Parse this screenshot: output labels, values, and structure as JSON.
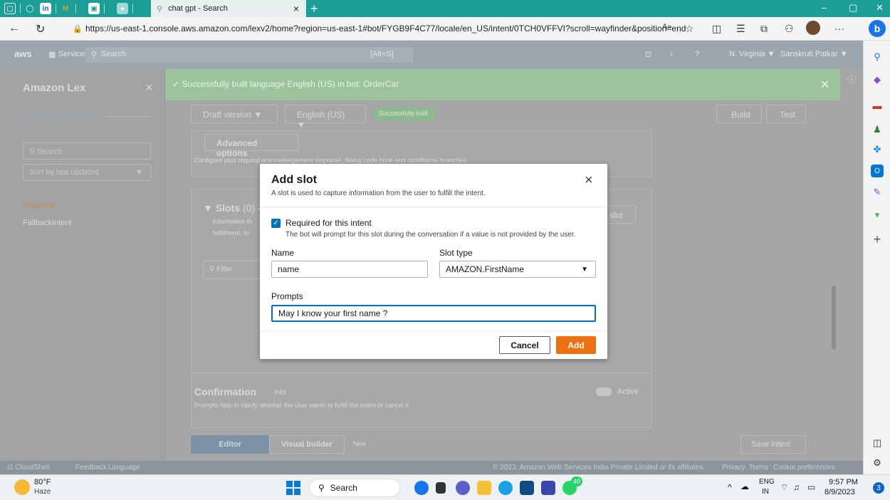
{
  "browser": {
    "tab_title": "chat gpt - Search",
    "tab_close": "×",
    "new_tab": "+",
    "url": "https://us-east-1.console.aws.amazon.com/lexv2/home?region=us-east-1#bot/FYGB9F4C77/locale/en_US/intent/0TCH0VFFVI?scroll=wayfinder&position=end",
    "profile_letter": "b"
  },
  "aws_nav": {
    "logo": "aws",
    "services": "Services",
    "search": "Search",
    "shortcut": "[Alt+S]",
    "region": "N. Virginia ▼",
    "user": "Sanskruti Patkar ▼"
  },
  "lex_sidebar": {
    "title": "Amazon Lex",
    "close": "×",
    "back_link": "Back to intents list (2)",
    "search_placeholder": "Search",
    "sort": "Sort by last updated",
    "intents": [
      "OrderCar",
      "FallbackIntent"
    ]
  },
  "flash": {
    "message": "Successfully built language English (US) in bot: OrderCar"
  },
  "editor": {
    "draft_version": "Draft version ▼",
    "language": "English (US) ▼",
    "build_status": "Successfully built",
    "build_button": "Build",
    "test_button": "Test",
    "advanced_options": "Advanced options",
    "advanced_desc": "Configure your request acknowledgement response, dialog code hook and conditional branches.",
    "slots_title": "Slots",
    "slots_count": "(0) -",
    "slots_desc_1": "Information th",
    "slots_desc_2": "fulfillment. In",
    "filter_placeholder": "Filter",
    "add_slot": "slot",
    "confirmation_title": "Confirmation",
    "confirmation_info": "Info",
    "confirmation_desc": "Prompts help to clarify whether the user wants to fulfill the intent or cancel it",
    "active_label": "Active",
    "tab_editor": "Editor",
    "tab_visual": "Visual builder",
    "tab_new": "New",
    "save_intent": "Save intent"
  },
  "footer": {
    "cloudshell": "CloudShell",
    "feedback": "Feedback",
    "language": "Language",
    "copyright": "© 2023, Amazon Web Services India Private Limited or its affiliates.",
    "privacy": "Privacy",
    "terms": "Terms",
    "cookies": "Cookie preferences"
  },
  "modal": {
    "title": "Add slot",
    "subtitle": "A slot is used to capture information from the user to fulfill the intent.",
    "required_label": "Required for this intent",
    "required_hint": "The bot will prompt for this slot during the conversation if a value is not provided by the user.",
    "required_checked": true,
    "name_label": "Name",
    "name_value": "name",
    "slot_type_label": "Slot type",
    "slot_type_value": "AMAZON.FirstName",
    "prompts_label": "Prompts",
    "prompts_value": "May I know your first name ?",
    "cancel": "Cancel",
    "add": "Add"
  },
  "taskbar": {
    "weather_temp": "80°F",
    "weather_desc": "Haze",
    "search": "Search",
    "badge": "40",
    "lang_1": "ENG",
    "lang_2": "IN",
    "time": "9:57 PM",
    "date": "8/9/2023"
  },
  "colors": {
    "accent_teal": "#1c9e97",
    "aws_orange": "#ec7211",
    "aws_blue": "#0073bb"
  }
}
